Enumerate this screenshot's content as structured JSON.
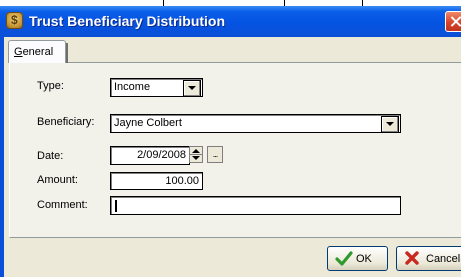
{
  "window": {
    "title": "Trust Beneficiary Distribution"
  },
  "tabs": [
    {
      "label_prefix": "G",
      "label_rest": "eneral"
    }
  ],
  "form": {
    "type": {
      "label": "Type:",
      "value": "Income"
    },
    "beneficiary": {
      "label": "Beneficiary:",
      "value": "Jayne Colbert"
    },
    "date": {
      "label": "Date:",
      "value": "2/09/2008",
      "picker_label": "..."
    },
    "amount": {
      "label": "Amount:",
      "value": "100.00"
    },
    "comment": {
      "label": "Comment:",
      "value": ""
    }
  },
  "buttons": {
    "ok": "OK",
    "cancel": "Cancel"
  },
  "colors": {
    "titlebar": "#0553e2",
    "close": "#d8432a",
    "ok_icon": "#2e9a2e",
    "cancel_icon": "#c8281e"
  }
}
